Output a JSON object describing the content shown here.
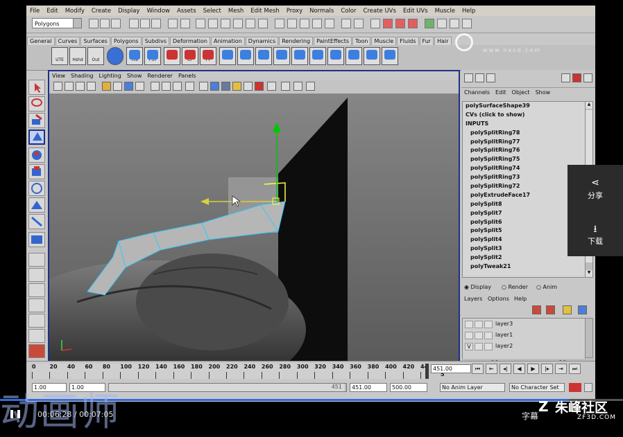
{
  "app": {
    "menu": [
      "File",
      "Edit",
      "Modify",
      "Create",
      "Display",
      "Window",
      "Assets",
      "Select",
      "Mesh",
      "Edit Mesh",
      "Proxy",
      "Normals",
      "Color",
      "Create UVs",
      "Edit UVs",
      "Muscle",
      "Help"
    ],
    "mode": "Polygons"
  },
  "shelf": {
    "tabs": [
      "General",
      "Curves",
      "Surfaces",
      "Polygons",
      "Subdivs",
      "Deformation",
      "Animation",
      "Dynamics",
      "Rendering",
      "PaintEffects",
      "Toon",
      "Muscle",
      "Fluids",
      "Fur",
      "Hair"
    ],
    "buttons": [
      "UTE",
      "Hshd",
      "Out",
      "",
      "Hls",
      "PST",
      "",
      "CP",
      "FT"
    ]
  },
  "watermark_top": "www.nxsd.com",
  "viewport": {
    "menu": [
      "View",
      "Shading",
      "Lighting",
      "Show",
      "Renderer",
      "Panels"
    ]
  },
  "channel_box": {
    "menu": [
      "Channels",
      "Edit",
      "Object",
      "Show"
    ],
    "object": "polySurfaceShape39",
    "cvs": "CVs (click to show)",
    "inputs_label": "INPUTS",
    "inputs": [
      "polySplitRing78",
      "polySplitRing77",
      "polySplitRing76",
      "polySplitRing75",
      "polySplitRing74",
      "polySplitRing73",
      "polySplitRing72",
      "polyExtrudeFace17",
      "polySplit8",
      "polySplit7",
      "polySplit6",
      "polySplit5",
      "polySplit4",
      "polySplit3",
      "polySplit2",
      "polyTweak21"
    ]
  },
  "layer_editor": {
    "tabs": [
      "Display",
      "Render",
      "Anim"
    ],
    "menu": [
      "Layers",
      "Options",
      "Help"
    ],
    "layers": [
      {
        "name": "layer3",
        "v": ""
      },
      {
        "name": "layer1",
        "v": ""
      },
      {
        "name": "layer2",
        "v": "V"
      }
    ]
  },
  "timeline": {
    "ticks": [
      "0",
      "20",
      "40",
      "60",
      "80",
      "100",
      "120",
      "140",
      "160",
      "180",
      "200",
      "220",
      "240",
      "260",
      "280",
      "300",
      "320",
      "340",
      "360",
      "380",
      "400",
      "420",
      "44"
    ],
    "current_frame": "451.00",
    "end_marker": "5"
  },
  "range": {
    "start": "1.00",
    "inner_start": "1.00",
    "inner_end_label": "451",
    "anim_end": "451.00",
    "end": "500.00",
    "anim_layer": "No Anim Layer",
    "char_set": "No Character Set"
  },
  "side_panel": {
    "share": "分享",
    "download": "下载"
  },
  "overlay": {
    "course_title": "动画师",
    "time": "00:06:28 / 00:07:05",
    "subtitle_btn": "字幕",
    "brand": "朱峰社区",
    "brand_url": "ZF3D.COM"
  }
}
